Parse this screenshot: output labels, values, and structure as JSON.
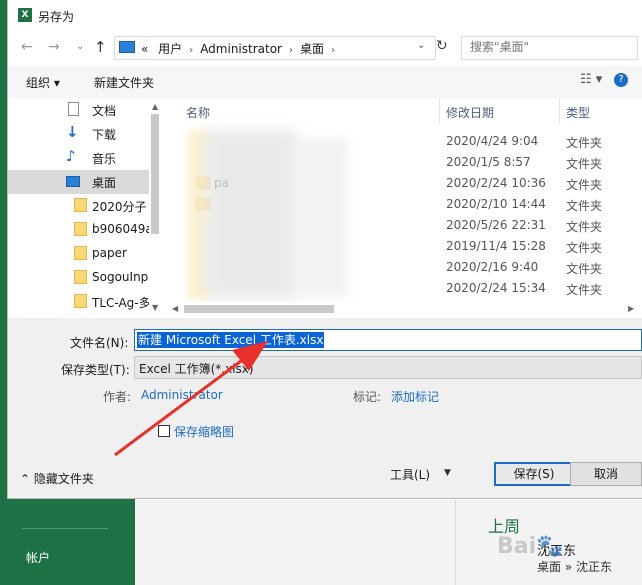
{
  "background": {
    "account_label": "帐户",
    "recent_heading": "上周",
    "recent_person": "沈正东",
    "recent_path": "桌面 » 沈正东"
  },
  "dialog": {
    "title": "另存为",
    "app_icon_letter": "X",
    "address": {
      "crumbs": [
        "«",
        "用户",
        "Administrator",
        "桌面"
      ],
      "search_placeholder": "搜索\"桌面\""
    },
    "toolbar": {
      "organize": "组织 ▾",
      "new_folder": "新建文件夹"
    },
    "nav": [
      {
        "label": "文档",
        "icon": "document-icon"
      },
      {
        "label": "下载",
        "icon": "download-icon"
      },
      {
        "label": "音乐",
        "icon": "music-icon"
      },
      {
        "label": "桌面",
        "icon": "desktop-icon",
        "selected": true
      },
      {
        "label": "2020分子",
        "icon": "folder-icon"
      },
      {
        "label": "b906049a",
        "icon": "folder-icon"
      },
      {
        "label": "paper",
        "icon": "folder-icon"
      },
      {
        "label": "SogouInp",
        "icon": "folder-icon"
      },
      {
        "label": "TLC-Ag-多",
        "icon": "folder-icon"
      }
    ],
    "columns": {
      "name": "名称",
      "date": "修改日期",
      "type": "类型"
    },
    "files": [
      {
        "name": "",
        "date": "2020/4/24 9:04",
        "type": "文件夹"
      },
      {
        "name": "",
        "date": "2020/1/5 8:57",
        "type": "文件夹"
      },
      {
        "name": "pa",
        "date": "2020/2/24 10:36",
        "type": "文件夹"
      },
      {
        "name": "",
        "date": "2020/2/10 14:44",
        "type": "文件夹"
      },
      {
        "name": "",
        "date": "2020/5/26 22:31",
        "type": "文件夹"
      },
      {
        "name": "",
        "date": "2019/11/4 15:28",
        "type": "文件夹"
      },
      {
        "name": "",
        "date": "2020/2/16 9:40",
        "type": "文件夹"
      },
      {
        "name": "",
        "date": "2020/2/24 15:34",
        "type": "文件夹"
      }
    ],
    "form": {
      "filename_label": "文件名(N):",
      "filename_value": "新建 Microsoft Excel 工作表.xlsx",
      "filetype_label": "保存类型(T):",
      "filetype_value": "Excel 工作簿(*.xlsx)",
      "author_label": "作者:",
      "author_value": "Administrator",
      "tags_label": "标记:",
      "tags_value": "添加标记",
      "thumbnail_label": "保存缩略图",
      "thumbnail_checked": false
    },
    "footer": {
      "hide_folders": "隐藏文件夹",
      "tools": "工具(L)",
      "save": "保存(S)",
      "cancel": "取消"
    }
  },
  "annotation_color": "#e8312a"
}
